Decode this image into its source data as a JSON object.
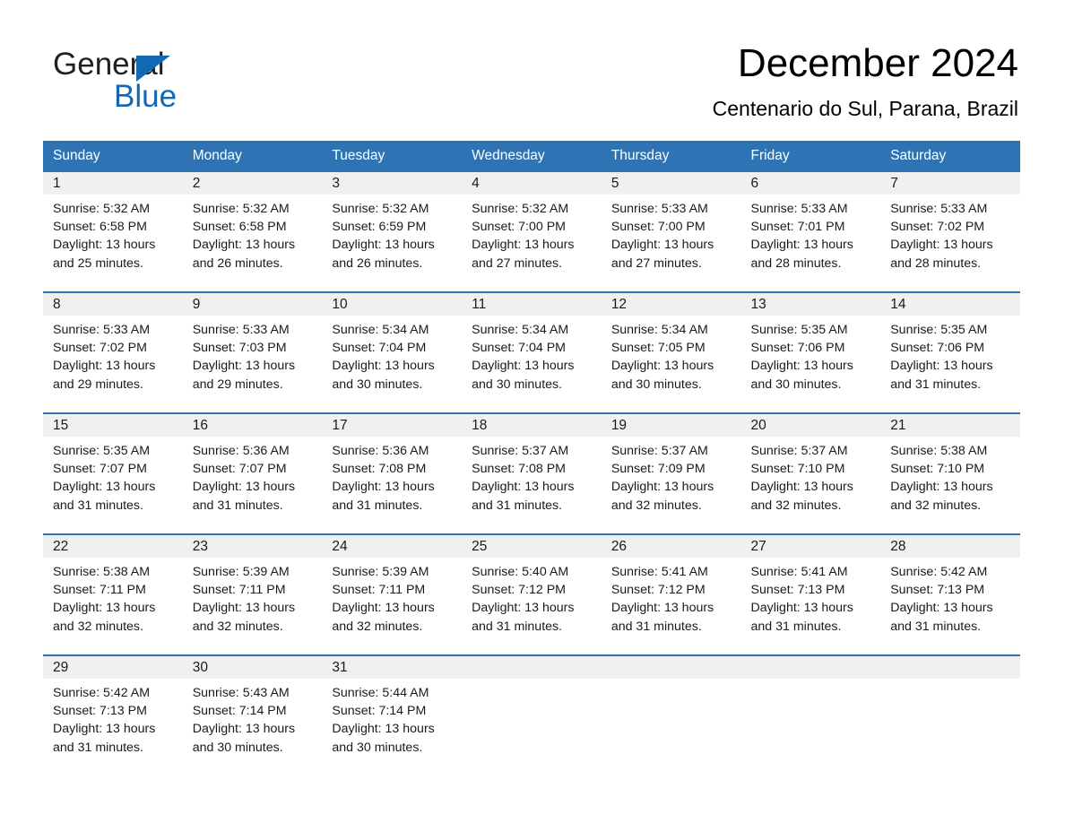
{
  "brand": {
    "line1": "General",
    "line2": "Blue",
    "accent_color": "#1268b3"
  },
  "header": {
    "title": "December 2024",
    "subtitle": "Centenario do Sul, Parana, Brazil",
    "header_bg_color": "#2e74b5",
    "daynum_bg_color": "#f0f0f0"
  },
  "weekdays": [
    "Sunday",
    "Monday",
    "Tuesday",
    "Wednesday",
    "Thursday",
    "Friday",
    "Saturday"
  ],
  "weeks": [
    [
      {
        "day": "1",
        "sunrise": "Sunrise: 5:32 AM",
        "sunset": "Sunset: 6:58 PM",
        "daylight_1": "Daylight: 13 hours",
        "daylight_2": "and 25 minutes."
      },
      {
        "day": "2",
        "sunrise": "Sunrise: 5:32 AM",
        "sunset": "Sunset: 6:58 PM",
        "daylight_1": "Daylight: 13 hours",
        "daylight_2": "and 26 minutes."
      },
      {
        "day": "3",
        "sunrise": "Sunrise: 5:32 AM",
        "sunset": "Sunset: 6:59 PM",
        "daylight_1": "Daylight: 13 hours",
        "daylight_2": "and 26 minutes."
      },
      {
        "day": "4",
        "sunrise": "Sunrise: 5:32 AM",
        "sunset": "Sunset: 7:00 PM",
        "daylight_1": "Daylight: 13 hours",
        "daylight_2": "and 27 minutes."
      },
      {
        "day": "5",
        "sunrise": "Sunrise: 5:33 AM",
        "sunset": "Sunset: 7:00 PM",
        "daylight_1": "Daylight: 13 hours",
        "daylight_2": "and 27 minutes."
      },
      {
        "day": "6",
        "sunrise": "Sunrise: 5:33 AM",
        "sunset": "Sunset: 7:01 PM",
        "daylight_1": "Daylight: 13 hours",
        "daylight_2": "and 28 minutes."
      },
      {
        "day": "7",
        "sunrise": "Sunrise: 5:33 AM",
        "sunset": "Sunset: 7:02 PM",
        "daylight_1": "Daylight: 13 hours",
        "daylight_2": "and 28 minutes."
      }
    ],
    [
      {
        "day": "8",
        "sunrise": "Sunrise: 5:33 AM",
        "sunset": "Sunset: 7:02 PM",
        "daylight_1": "Daylight: 13 hours",
        "daylight_2": "and 29 minutes."
      },
      {
        "day": "9",
        "sunrise": "Sunrise: 5:33 AM",
        "sunset": "Sunset: 7:03 PM",
        "daylight_1": "Daylight: 13 hours",
        "daylight_2": "and 29 minutes."
      },
      {
        "day": "10",
        "sunrise": "Sunrise: 5:34 AM",
        "sunset": "Sunset: 7:04 PM",
        "daylight_1": "Daylight: 13 hours",
        "daylight_2": "and 30 minutes."
      },
      {
        "day": "11",
        "sunrise": "Sunrise: 5:34 AM",
        "sunset": "Sunset: 7:04 PM",
        "daylight_1": "Daylight: 13 hours",
        "daylight_2": "and 30 minutes."
      },
      {
        "day": "12",
        "sunrise": "Sunrise: 5:34 AM",
        "sunset": "Sunset: 7:05 PM",
        "daylight_1": "Daylight: 13 hours",
        "daylight_2": "and 30 minutes."
      },
      {
        "day": "13",
        "sunrise": "Sunrise: 5:35 AM",
        "sunset": "Sunset: 7:06 PM",
        "daylight_1": "Daylight: 13 hours",
        "daylight_2": "and 30 minutes."
      },
      {
        "day": "14",
        "sunrise": "Sunrise: 5:35 AM",
        "sunset": "Sunset: 7:06 PM",
        "daylight_1": "Daylight: 13 hours",
        "daylight_2": "and 31 minutes."
      }
    ],
    [
      {
        "day": "15",
        "sunrise": "Sunrise: 5:35 AM",
        "sunset": "Sunset: 7:07 PM",
        "daylight_1": "Daylight: 13 hours",
        "daylight_2": "and 31 minutes."
      },
      {
        "day": "16",
        "sunrise": "Sunrise: 5:36 AM",
        "sunset": "Sunset: 7:07 PM",
        "daylight_1": "Daylight: 13 hours",
        "daylight_2": "and 31 minutes."
      },
      {
        "day": "17",
        "sunrise": "Sunrise: 5:36 AM",
        "sunset": "Sunset: 7:08 PM",
        "daylight_1": "Daylight: 13 hours",
        "daylight_2": "and 31 minutes."
      },
      {
        "day": "18",
        "sunrise": "Sunrise: 5:37 AM",
        "sunset": "Sunset: 7:08 PM",
        "daylight_1": "Daylight: 13 hours",
        "daylight_2": "and 31 minutes."
      },
      {
        "day": "19",
        "sunrise": "Sunrise: 5:37 AM",
        "sunset": "Sunset: 7:09 PM",
        "daylight_1": "Daylight: 13 hours",
        "daylight_2": "and 32 minutes."
      },
      {
        "day": "20",
        "sunrise": "Sunrise: 5:37 AM",
        "sunset": "Sunset: 7:10 PM",
        "daylight_1": "Daylight: 13 hours",
        "daylight_2": "and 32 minutes."
      },
      {
        "day": "21",
        "sunrise": "Sunrise: 5:38 AM",
        "sunset": "Sunset: 7:10 PM",
        "daylight_1": "Daylight: 13 hours",
        "daylight_2": "and 32 minutes."
      }
    ],
    [
      {
        "day": "22",
        "sunrise": "Sunrise: 5:38 AM",
        "sunset": "Sunset: 7:11 PM",
        "daylight_1": "Daylight: 13 hours",
        "daylight_2": "and 32 minutes."
      },
      {
        "day": "23",
        "sunrise": "Sunrise: 5:39 AM",
        "sunset": "Sunset: 7:11 PM",
        "daylight_1": "Daylight: 13 hours",
        "daylight_2": "and 32 minutes."
      },
      {
        "day": "24",
        "sunrise": "Sunrise: 5:39 AM",
        "sunset": "Sunset: 7:11 PM",
        "daylight_1": "Daylight: 13 hours",
        "daylight_2": "and 32 minutes."
      },
      {
        "day": "25",
        "sunrise": "Sunrise: 5:40 AM",
        "sunset": "Sunset: 7:12 PM",
        "daylight_1": "Daylight: 13 hours",
        "daylight_2": "and 31 minutes."
      },
      {
        "day": "26",
        "sunrise": "Sunrise: 5:41 AM",
        "sunset": "Sunset: 7:12 PM",
        "daylight_1": "Daylight: 13 hours",
        "daylight_2": "and 31 minutes."
      },
      {
        "day": "27",
        "sunrise": "Sunrise: 5:41 AM",
        "sunset": "Sunset: 7:13 PM",
        "daylight_1": "Daylight: 13 hours",
        "daylight_2": "and 31 minutes."
      },
      {
        "day": "28",
        "sunrise": "Sunrise: 5:42 AM",
        "sunset": "Sunset: 7:13 PM",
        "daylight_1": "Daylight: 13 hours",
        "daylight_2": "and 31 minutes."
      }
    ],
    [
      {
        "day": "29",
        "sunrise": "Sunrise: 5:42 AM",
        "sunset": "Sunset: 7:13 PM",
        "daylight_1": "Daylight: 13 hours",
        "daylight_2": "and 31 minutes."
      },
      {
        "day": "30",
        "sunrise": "Sunrise: 5:43 AM",
        "sunset": "Sunset: 7:14 PM",
        "daylight_1": "Daylight: 13 hours",
        "daylight_2": "and 30 minutes."
      },
      {
        "day": "31",
        "sunrise": "Sunrise: 5:44 AM",
        "sunset": "Sunset: 7:14 PM",
        "daylight_1": "Daylight: 13 hours",
        "daylight_2": "and 30 minutes."
      },
      {
        "day": "",
        "sunrise": "",
        "sunset": "",
        "daylight_1": "",
        "daylight_2": ""
      },
      {
        "day": "",
        "sunrise": "",
        "sunset": "",
        "daylight_1": "",
        "daylight_2": ""
      },
      {
        "day": "",
        "sunrise": "",
        "sunset": "",
        "daylight_1": "",
        "daylight_2": ""
      },
      {
        "day": "",
        "sunrise": "",
        "sunset": "",
        "daylight_1": "",
        "daylight_2": ""
      }
    ]
  ]
}
